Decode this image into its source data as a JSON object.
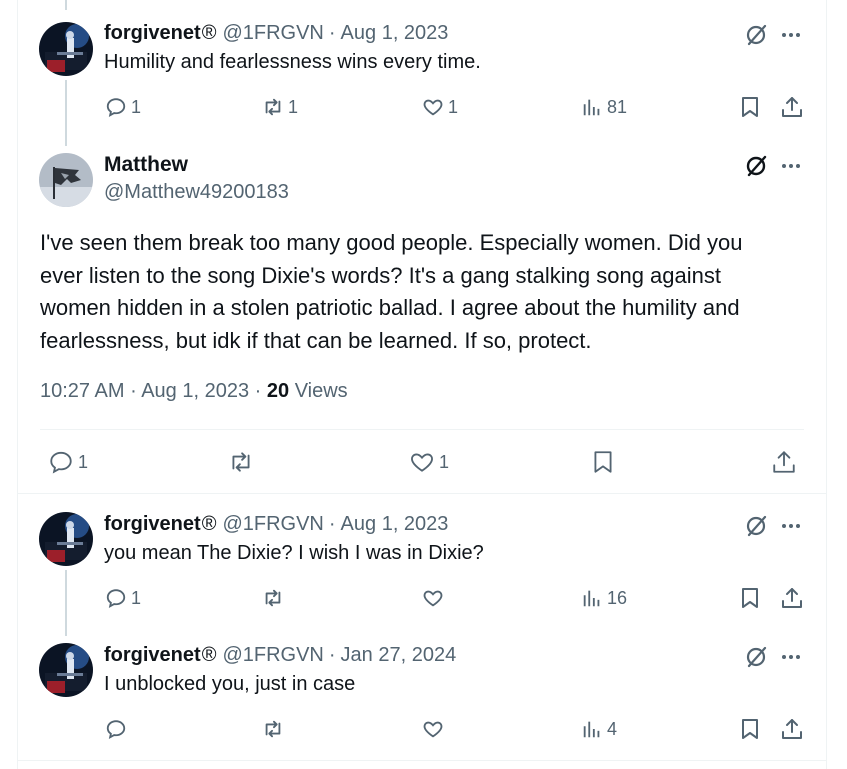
{
  "colors": {
    "text": "#0f1419",
    "muted": "#536471",
    "border": "#eff3f4",
    "thread": "#cfd9de"
  },
  "tweets": [
    {
      "name": "forgivenet",
      "badge": "®",
      "handle": "@1FRGVN",
      "separator": "·",
      "date": "Aug 1, 2023",
      "text": "Humility and fearlessness wins every time.",
      "replies": "1",
      "reposts": "1",
      "likes": "1",
      "views": "81"
    },
    {
      "name": "forgivenet",
      "badge": "®",
      "handle": "@1FRGVN",
      "separator": "·",
      "date": "Aug 1, 2023",
      "text": "you mean The Dixie? I wish I was in Dixie?",
      "replies": "1",
      "reposts": "",
      "likes": "",
      "views": "16"
    },
    {
      "name": "forgivenet",
      "badge": "®",
      "handle": "@1FRGVN",
      "separator": "·",
      "date": "Jan 27, 2024",
      "text": "I unblocked you, just in case",
      "replies": "",
      "reposts": "",
      "likes": "",
      "views": "4"
    }
  ],
  "main": {
    "name": "Matthew",
    "handle": "@Matthew49200183",
    "body_lines": [
      "I've seen them break too many good people. Especially women.  Did you",
      "ever listen to the song Dixie's words?  It's a gang stalking song against",
      "women hidden in a stolen patriotic ballad. I agree about the humility and",
      "fearlessness, but idk if that can be learned. If so, protect."
    ],
    "time": "10:27 AM",
    "separator": "·",
    "date": "Aug 1, 2023",
    "views_count": "20",
    "views_label": "Views",
    "replies": "1",
    "likes": "1"
  }
}
